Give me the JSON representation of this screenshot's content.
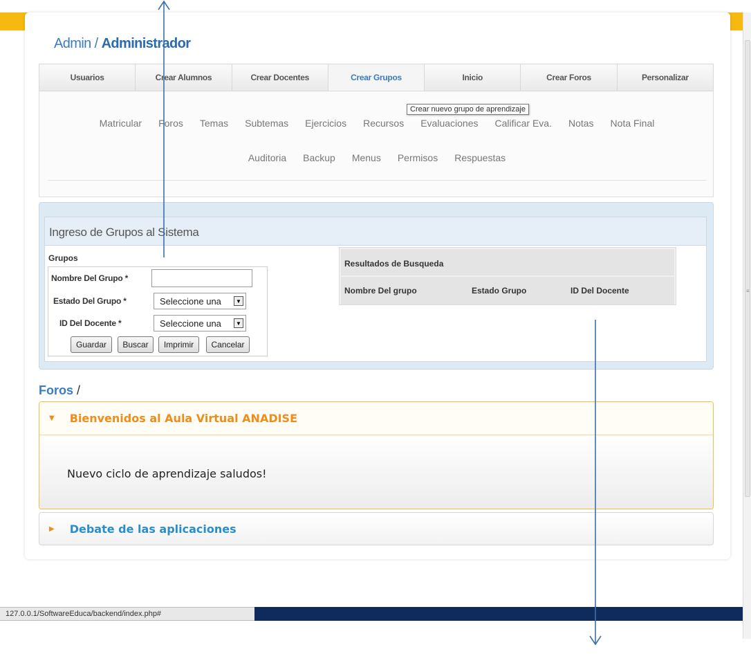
{
  "header": {
    "prefix": "Admin / ",
    "role": "Administrador"
  },
  "nav": {
    "items": [
      "Usuarios",
      "Crear Alumnos",
      "Crear Docentes",
      "Crear Grupos",
      "Inicio",
      "Crear Foros",
      "Personalizar"
    ],
    "active": "Crear Grupos"
  },
  "subnav": {
    "row1": [
      "Matricular",
      "Foros",
      "Temas",
      "Subtemas",
      "Ejercicios",
      "Recursos",
      "Evaluaciones",
      "Calificar Eva.",
      "Notas",
      "Nota Final"
    ],
    "row2": [
      "Auditoria",
      "Backup",
      "Menus",
      "Permisos",
      "Respuestas"
    ]
  },
  "tooltip": "Crear nuevo grupo de aprendizaje",
  "panel": {
    "title": "Ingreso de Grupos al Sistema"
  },
  "form": {
    "section": "Grupos",
    "nombre_label": "Nombre Del Grupo *",
    "nombre_value": "",
    "estado_label": "Estado Del Grupo *",
    "estado_value": "Seleccione una",
    "docente_label": "ID Del Docente *",
    "docente_value": "Seleccione una",
    "buttons": {
      "guardar": "Guardar",
      "buscar": "Buscar",
      "imprimir": "Imprimir",
      "cancelar": "Cancelar"
    }
  },
  "results": {
    "title": "Resultados de Busqueda",
    "columns": [
      "Nombre Del grupo",
      "Estado Grupo",
      "ID Del Docente"
    ]
  },
  "foros": {
    "title": "Foros",
    "slash": " /",
    "items": [
      {
        "title": "Bienvenidos al Aula Virtual ANADISE",
        "body": "Nuevo ciclo de aprendizaje saludos!",
        "expanded": true
      },
      {
        "title": "Debate de las aplicaciones",
        "expanded": false
      }
    ]
  },
  "statusbar": {
    "url": "127.0.0.1/SoftwareEduca/backend/index.php#"
  },
  "colors": {
    "accent_blue": "#3b7bbf",
    "orange": "#ef8c1a",
    "top_band": "#f6b90f",
    "dark_band": "#0f2a5c",
    "arrow": "#3d6fa8"
  }
}
